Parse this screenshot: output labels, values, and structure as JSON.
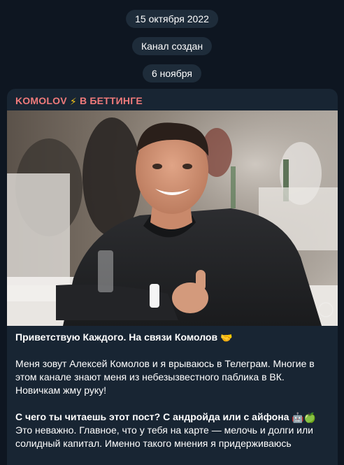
{
  "service": {
    "date_top": "15 октября 2022",
    "channel_created": "Канал создан",
    "date_post": "6 ноября"
  },
  "post": {
    "channel_name_left": "KOMOLOV",
    "channel_name_right": "В БЕТТИНГЕ",
    "name_separator_icon": "lightning-icon",
    "greeting": "Приветствую Каждого. На связи Комолов",
    "greeting_icon": "handshake-icon",
    "para1": "Меня зовут Алексей Комолов и я врываюсь в Телеграм. Многие в этом канале знают меня из небезызвестного паблика в ВК. Новичкам жму руку!",
    "para2_bold": "С чего ты читаешь этот пост? С андройда или с айфона",
    "para2_icons": [
      "robot-icon",
      "green-apple-icon"
    ],
    "para2_rest": "Это неважно. Главное, что у тебя на карте — мелочь и долги или солидный капитал. Именно такого мнения я придерживаюсь"
  },
  "colors": {
    "background": "#0e1621",
    "bubble": "#182533",
    "pill": "#1e2c3a",
    "channel_name": "#f07b7b"
  }
}
